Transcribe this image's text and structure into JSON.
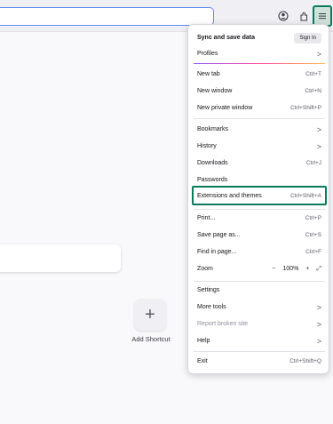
{
  "menu": {
    "sync": {
      "label": "Sync and save data",
      "button": "Sign In"
    },
    "profiles": "Profiles",
    "new_tab": {
      "label": "New tab",
      "shortcut": "Ctrl+T"
    },
    "new_window": {
      "label": "New window",
      "shortcut": "Ctrl+N"
    },
    "new_private_window": {
      "label": "New private window",
      "shortcut": "Ctrl+Shift+P"
    },
    "bookmarks": "Bookmarks",
    "history": "History",
    "downloads": {
      "label": "Downloads",
      "shortcut": "Ctrl+J"
    },
    "passwords": "Passwords",
    "extensions": {
      "label": "Extensions and themes",
      "shortcut": "Ctrl+Shift+A"
    },
    "print": {
      "label": "Print...",
      "shortcut": "Ctrl+P"
    },
    "save_page": {
      "label": "Save page as...",
      "shortcut": "Ctrl+S"
    },
    "find": {
      "label": "Find in page...",
      "shortcut": "Ctrl+F"
    },
    "zoom": {
      "label": "Zoom",
      "minus": "−",
      "value": "100%",
      "plus": "+",
      "fullscreen": "⤢"
    },
    "settings": "Settings",
    "more_tools": "More tools",
    "report": "Report broken site",
    "help": "Help",
    "exit": {
      "label": "Exit",
      "shortcut": "Ctrl+Shift+Q"
    },
    "chevron": ">"
  },
  "newtab": {
    "shortcut_label": "Add Shortcut",
    "shortcut_plus": "+"
  },
  "colors": {
    "highlight": "#0b7a5d",
    "accent": "#5b8def"
  },
  "icons": {
    "account": "account-icon",
    "extensions": "extensions-icon",
    "menu": "hamburger-menu-icon"
  }
}
